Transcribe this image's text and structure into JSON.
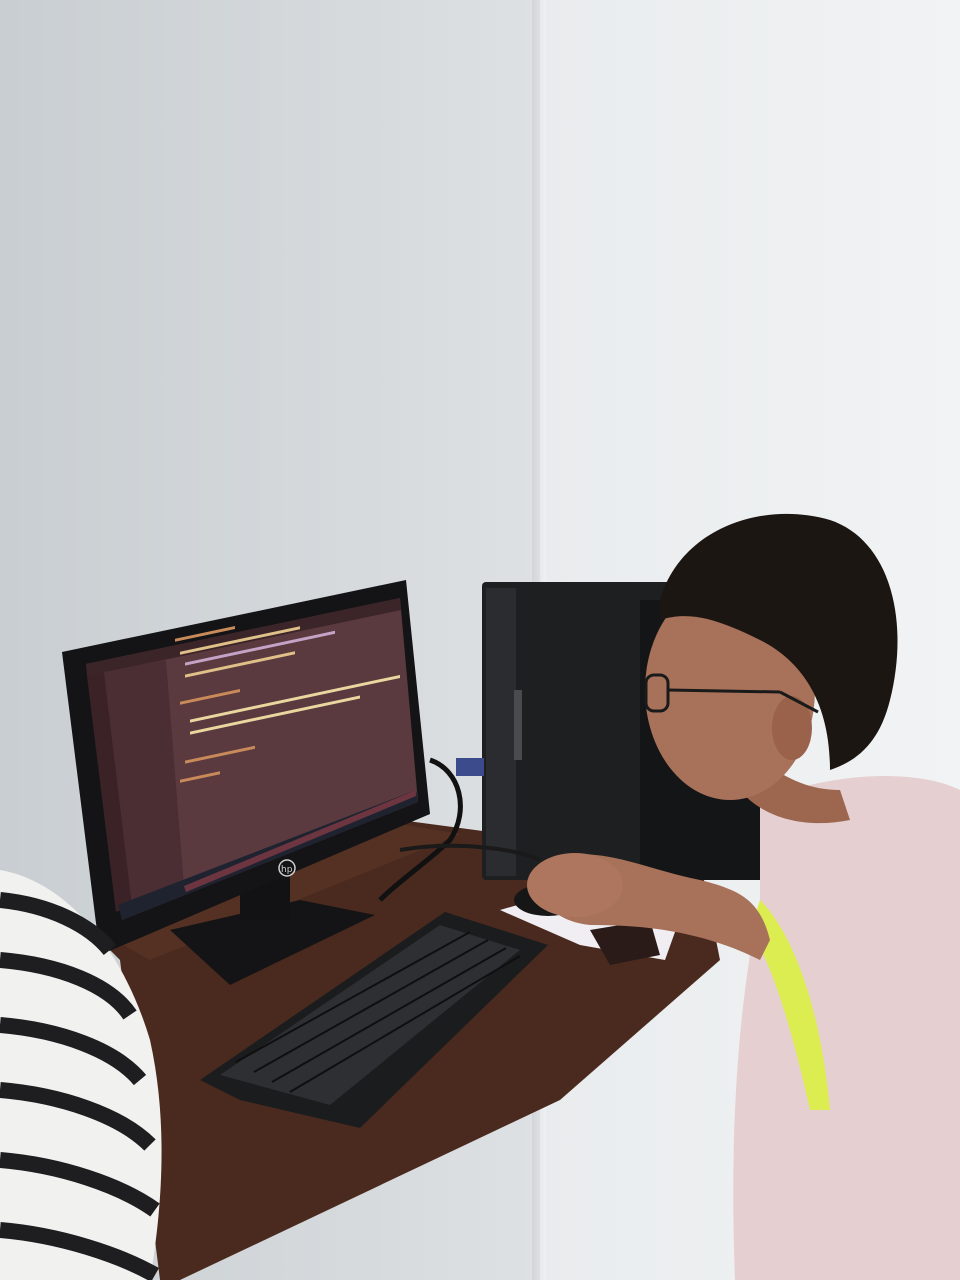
{
  "scene": {
    "subject": "person-at-computer",
    "colors": {
      "wall_left": "#d3d7da",
      "wall_right": "#eef0f1",
      "desk": "#4a2a1e",
      "monitor_bezel": "#141416",
      "editor_bg": "#5b3a3f",
      "shirt": "#e6cfd0",
      "shirt_print": "#d8f23a",
      "skin": "#a8715a",
      "hair": "#1c1613"
    }
  },
  "monitor": {
    "brand_logo": "hp-logo",
    "editor": {
      "icons": [
        "files-icon",
        "search-icon",
        "source-control-icon",
        "run-debug-icon",
        "extensions-icon",
        "account-icon",
        "settings-icon"
      ]
    }
  },
  "mousepad": {
    "icon": "animal-print-icon"
  }
}
